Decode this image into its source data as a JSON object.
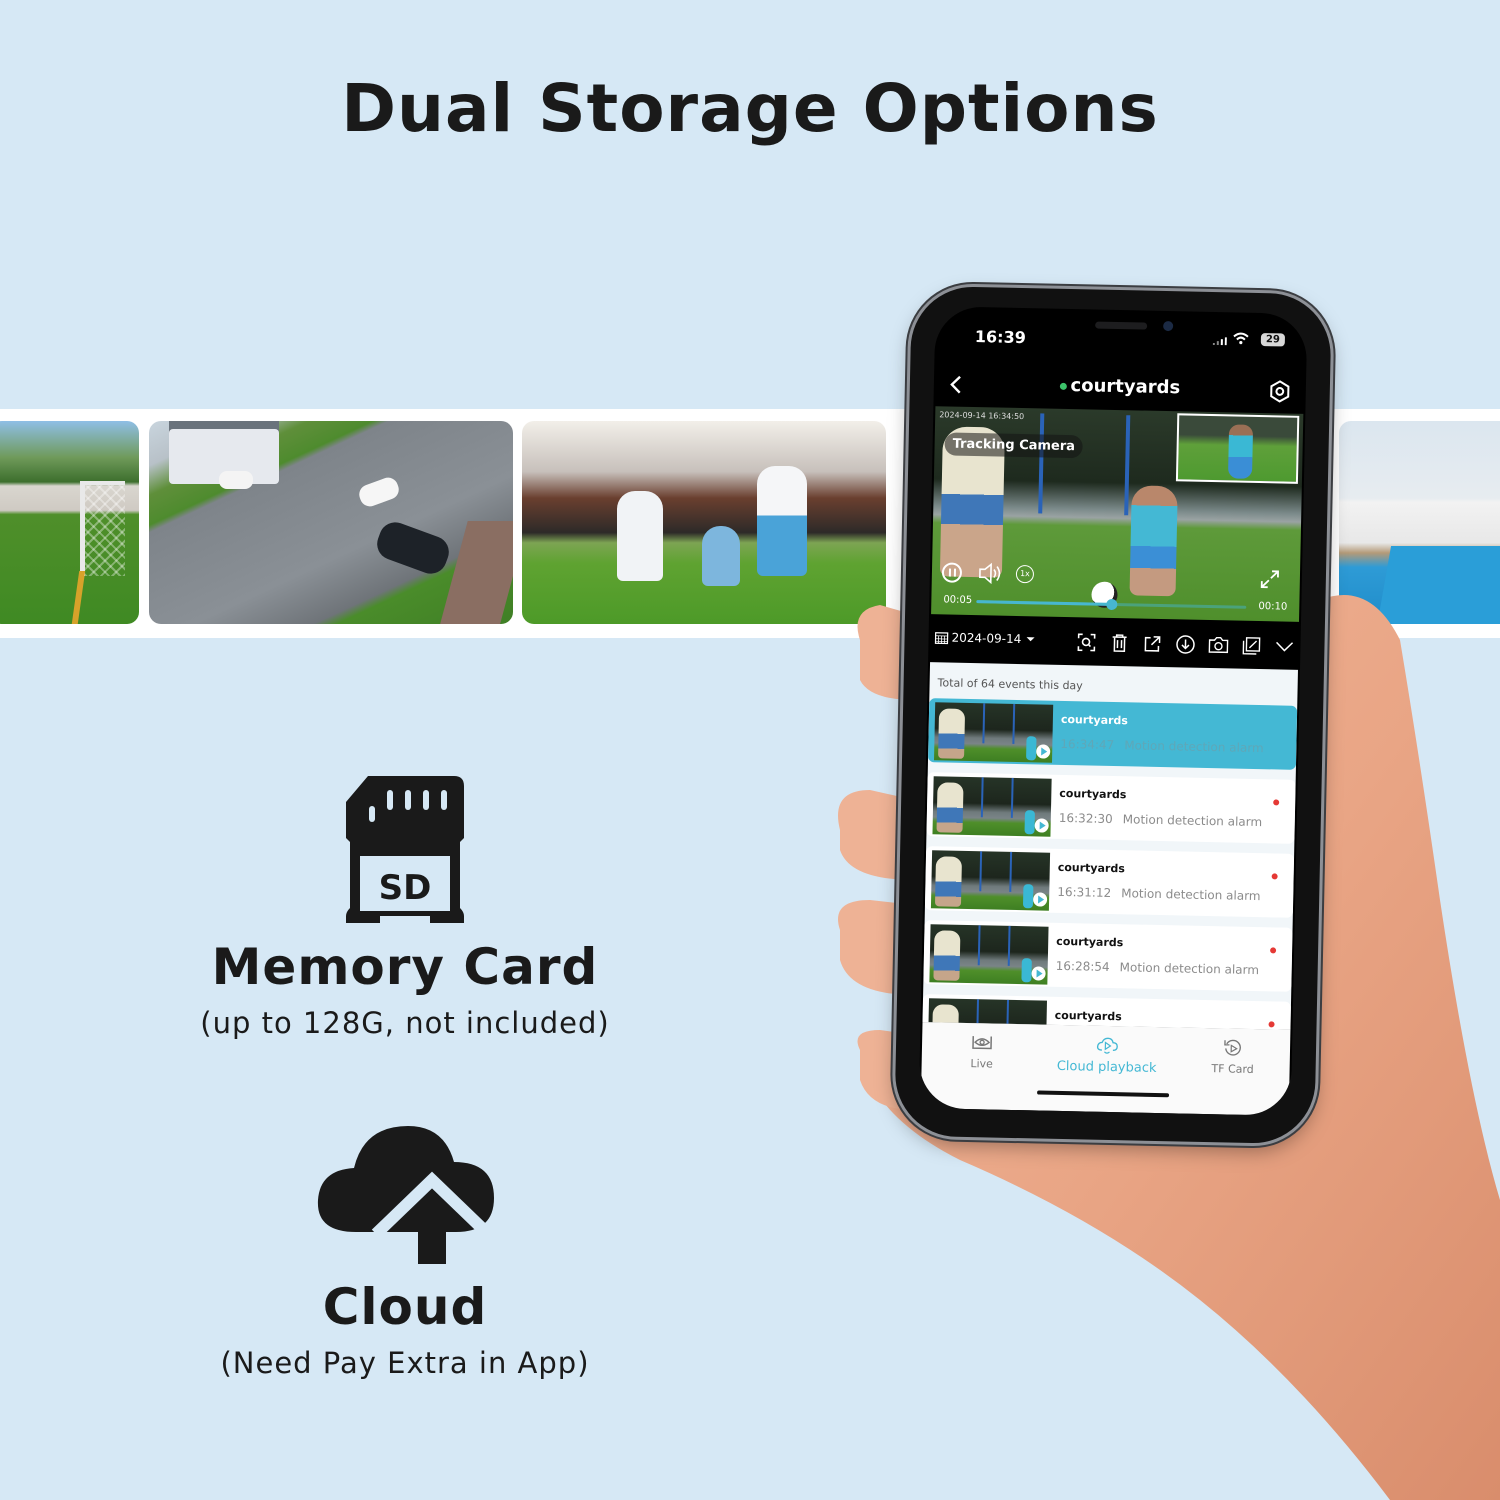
{
  "headline": "Dual Storage Options",
  "photo_strip": [
    {
      "label": "soccer-field"
    },
    {
      "label": "neighborhood-street"
    },
    {
      "label": "family-in-yard"
    },
    {
      "label": "pool-house"
    }
  ],
  "features": [
    {
      "icon": "sd-card-icon",
      "icon_text": "SD",
      "title": "Memory Card",
      "subtitle": "(up to 128G, not included)"
    },
    {
      "icon": "cloud-upload-icon",
      "title": "Cloud",
      "subtitle": "(Need Pay Extra in App)"
    }
  ],
  "phone": {
    "status": {
      "time": "16:39",
      "battery": "29"
    },
    "app_bar": {
      "title": "courtyards",
      "online": true,
      "back_icon": "chevron-left-icon",
      "settings_icon": "gear-icon"
    },
    "video": {
      "timestamp": "2024-09-14 16:34:50",
      "badge": "Tracking Camera",
      "speed": "1x",
      "current_time": "00:05",
      "duration": "00:10",
      "progress": 0.5
    },
    "toolbar": {
      "date": "2024-09-14",
      "tools": [
        "zoom-scan-icon",
        "trash-icon",
        "share-icon",
        "download-icon",
        "camera-icon",
        "edit-icon",
        "chevron-down-icon"
      ]
    },
    "events_summary": "Total of 64 events this day",
    "events": [
      {
        "camera": "courtyards",
        "time": "16:34:47",
        "type": "Motion detection alarm",
        "active": true,
        "unread": false
      },
      {
        "camera": "courtyards",
        "time": "16:32:30",
        "type": "Motion detection alarm",
        "active": false,
        "unread": true
      },
      {
        "camera": "courtyards",
        "time": "16:31:12",
        "type": "Motion detection alarm",
        "active": false,
        "unread": true
      },
      {
        "camera": "courtyards",
        "time": "16:28:54",
        "type": "Motion detection alarm",
        "active": false,
        "unread": true
      },
      {
        "camera": "courtyards",
        "time": "",
        "type": "",
        "active": false,
        "unread": true
      }
    ],
    "tabs": [
      {
        "label": "Live",
        "icon": "eye-icon",
        "active": false
      },
      {
        "label": "Cloud playback",
        "icon": "cloud-play-icon",
        "active": true
      },
      {
        "label": "TF Card",
        "icon": "replay-icon",
        "active": false
      }
    ]
  },
  "colors": {
    "accent": "#44b8d4",
    "background": "#d6e8f5",
    "online": "#3cc36a",
    "unread": "#e53935"
  }
}
